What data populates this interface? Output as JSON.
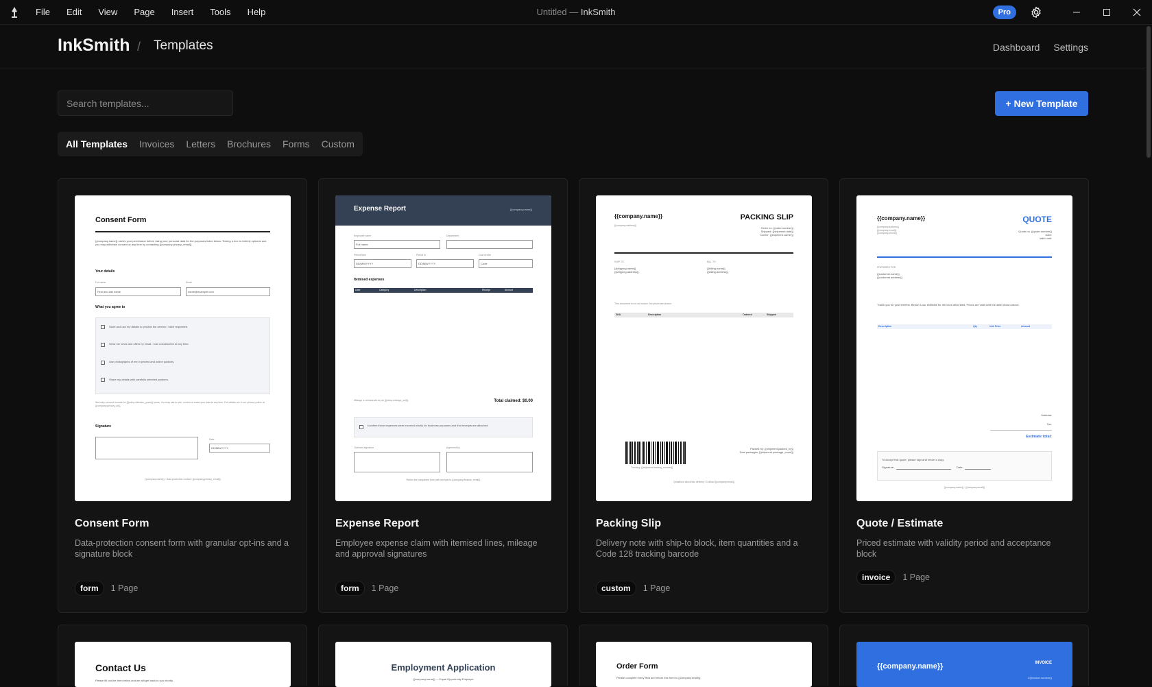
{
  "window": {
    "menu": [
      "File",
      "Edit",
      "View",
      "Page",
      "Insert",
      "Tools",
      "Help"
    ],
    "doc_title": "Untitled",
    "app_title": "InkSmith",
    "pro_badge": "Pro"
  },
  "header": {
    "brand": "InkSmith",
    "separator": "/",
    "crumb": "Templates",
    "nav": [
      "Dashboard",
      "Settings"
    ]
  },
  "toolbar": {
    "search_placeholder": "Search templates...",
    "new_button": "+ New Template"
  },
  "filters": [
    "All Templates",
    "Invoices",
    "Letters",
    "Brochures",
    "Forms",
    "Custom"
  ],
  "templates": [
    {
      "title": "Consent Form",
      "desc": "Data-protection consent form with granular opt-ins and a signature block",
      "tag": "form",
      "pages": "1 Page"
    },
    {
      "title": "Expense Report",
      "desc": "Employee expense claim with itemised lines, mileage and approval signatures",
      "tag": "form",
      "pages": "1 Page"
    },
    {
      "title": "Packing Slip",
      "desc": "Delivery note with ship-to block, item quantities and a Code 128 tracking barcode",
      "tag": "custom",
      "pages": "1 Page"
    },
    {
      "title": "Quote / Estimate",
      "desc": "Priced estimate with validity period and acceptance block",
      "tag": "invoice",
      "pages": "1 Page"
    }
  ],
  "previews": {
    "consent": {
      "heading": "Consent Form",
      "intro": "{{company.name}} needs your permission before using your personal data for the purposes listed below. Ticking a box is entirely optional and you may withdraw consent at any time by contacting {{company.privacy_email}}.",
      "details": "Your details",
      "fullname_label": "Full name",
      "fullname_ph": "First and last name",
      "email_label": "Email",
      "email_ph": "name@example.com",
      "agree": "What you agree to",
      "options": [
        "Store and use my details to provide the service I have requested.",
        "Send me news and offers by email. I can unsubscribe at any time.",
        "Use photographs of me in printed and online publicity.",
        "Share my details with carefully selected partners."
      ],
      "retention": "We keep consent records for {{policy.retention_years}} years. You may ask to see, correct or erase your data at any time. Full details are in our privacy notice at {{company.privacy_url}}.",
      "signature": "Signature",
      "date_label": "Date",
      "date_ph": "DD/MM/YYYY",
      "footer": "{{company.name}} · Data protection contact: {{company.privacy_email}}"
    },
    "expense": {
      "heading": "Expense Report",
      "company": "{{company.name}}",
      "emp_label": "Employee name",
      "emp_ph": "Full name",
      "dept_label": "Department",
      "from_label": "Period from",
      "from_ph": "DD/MM/YYYY",
      "to_label": "Period to",
      "to_ph": "DD/MM/YYYY",
      "cost_label": "Cost centre",
      "cost_ph": "Code",
      "items": "Itemised expenses",
      "cols": [
        "Date",
        "Category",
        "Description",
        "Receipt",
        "Amount"
      ],
      "mileage": "Mileage is reimbursed at per {{policy.mileage_unit}}.",
      "total": "Total claimed: $0.00",
      "confirm": "I confirm these expenses were incurred wholly for business purposes and that receipts are attached.",
      "claimant": "Claimant signature",
      "approved": "Approved by",
      "footer": "Return the completed form with receipts to {{company.finance_email}}"
    },
    "packing": {
      "company": "{{company.name}}",
      "address": "{{company.address}}",
      "heading": "PACKING SLIP",
      "order_lines": [
        "Order no. {{order.number}}",
        "Shipped: {{shipment.date}}",
        "Carrier: {{shipment.carrier}}"
      ],
      "ship_to": "SHIP TO",
      "ship_lines": [
        "{{shipping.name}}",
        "{{shipping.address}}"
      ],
      "bill_to": "BILL TO",
      "bill_lines": [
        "{{billing.name}}",
        "{{billing.address}}"
      ],
      "note": "This document is not an invoice. No prices are shown.",
      "cols": [
        "SKU",
        "Description",
        "Ordered",
        "Shipped"
      ],
      "tracking": "Tracking: {{shipment.tracking_number}}",
      "packed_lines": [
        "Packed by: {{shipment.packed_by}}",
        "Total packages: {{shipment.package_count}}"
      ],
      "footer": "Questions about this delivery? Contact {{company.email}}"
    },
    "quote": {
      "company": "{{company.name}}",
      "heading": "QUOTE",
      "addr_lines": [
        "{{company.address}}",
        "{{company.email}}",
        "{{company.phone}}"
      ],
      "meta_lines": [
        "Quote no. {{quote.number}}",
        "Date:",
        "Valid until:"
      ],
      "prepared": "PREPARED FOR",
      "cust_lines": [
        "{{customer.name}}",
        "{{customer.address}}"
      ],
      "thanks": "Thank you for your interest. Below is our estimate for the work described. Prices are valid until the date shown above.",
      "cols": [
        "Description",
        "Qty",
        "Unit Price",
        "Amount"
      ],
      "subtotal": "Subtotal:",
      "tax": "Tax:",
      "total": "Estimate total:",
      "accept": "To accept this quote, please sign and return a copy.",
      "sign": "Signature:",
      "date": "Date:",
      "footer": "{{company.name}} · {{company.email}}"
    },
    "row2": {
      "contact_title": "Contact Us",
      "contact_sub": "Please fill out the form below and we will get back to you shortly.",
      "employment_title": "Employment Application",
      "employment_sub": "{{company.name}} — Equal Opportunity Employer",
      "order_title": "Order Form",
      "order_sub": "Please complete every field and return this form to {{company.email}}.",
      "invoice_company": "{{company.name}}",
      "invoice_label": "INVOICE",
      "invoice_num": "#{{invoice.number}}"
    }
  }
}
